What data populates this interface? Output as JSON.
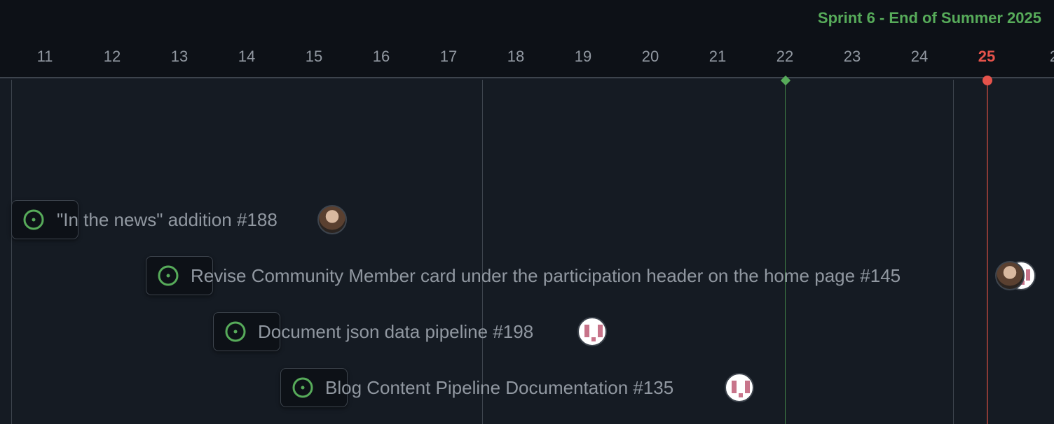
{
  "sprint": {
    "title": "Sprint 6 - End of Summer 2025"
  },
  "timeline": {
    "days": [
      "11",
      "12",
      "13",
      "14",
      "15",
      "16",
      "17",
      "18",
      "19",
      "20",
      "21",
      "22",
      "23",
      "24",
      "25",
      "2"
    ],
    "today": "25",
    "milestone_day": "22"
  },
  "items": [
    {
      "title": "\"In the news\" addition #188",
      "status": "open",
      "assignees": [
        "photo-avatar"
      ]
    },
    {
      "title": "Revise Community Member card under the participation header on the home page #145",
      "status": "open",
      "assignees": [
        "photo-avatar",
        "identicon-avatar"
      ]
    },
    {
      "title": "Document json data pipeline #198",
      "status": "open",
      "assignees": [
        "identicon-avatar"
      ]
    },
    {
      "title": "Blog Content Pipeline Documentation #135",
      "status": "open",
      "assignees": [
        "identicon-avatar"
      ]
    }
  ],
  "colors": {
    "background": "#151b23",
    "header": "#0d1117",
    "open_status": "#57ab5a",
    "today": "#e5534b",
    "milestone": "#57ab5a"
  }
}
